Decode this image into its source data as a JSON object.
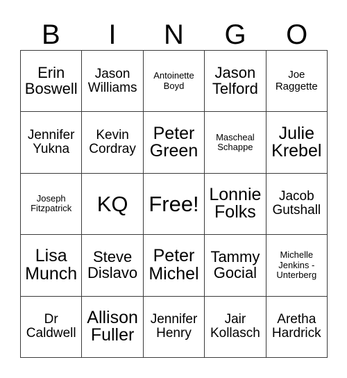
{
  "card": {
    "type": "bingo-card",
    "columns": 5,
    "rows": 5,
    "border_color": "#3a3a3a",
    "background_color": "#ffffff",
    "text_color": "#000000"
  },
  "header": {
    "letters": [
      "B",
      "I",
      "N",
      "G",
      "O"
    ]
  },
  "grid": {
    "rows": [
      [
        {
          "text": "Erin Boswell",
          "size": "l"
        },
        {
          "text": "Jason Williams",
          "size": "m"
        },
        {
          "text": "Antoinette Boyd",
          "size": "xs"
        },
        {
          "text": "Jason Telford",
          "size": "l"
        },
        {
          "text": "Joe Raggette",
          "size": "s"
        }
      ],
      [
        {
          "text": "Jennifer Yukna",
          "size": "m"
        },
        {
          "text": "Kevin Cordray",
          "size": "m"
        },
        {
          "text": "Peter Green",
          "size": "xl"
        },
        {
          "text": "Mascheal Schappe",
          "size": "xs"
        },
        {
          "text": "Julie Krebel",
          "size": "xl"
        }
      ],
      [
        {
          "text": "Joseph Fitzpatrick",
          "size": "xs"
        },
        {
          "text": "KQ",
          "size": "xxl"
        },
        {
          "text": "Free!",
          "size": "xxl"
        },
        {
          "text": "Lonnie Folks",
          "size": "xl"
        },
        {
          "text": "Jacob Gutshall",
          "size": "m"
        }
      ],
      [
        {
          "text": "Lisa Munch",
          "size": "xl"
        },
        {
          "text": "Steve Dislavo",
          "size": "l"
        },
        {
          "text": "Peter Michel",
          "size": "xl"
        },
        {
          "text": "Tammy Gocial",
          "size": "l"
        },
        {
          "text": "Michelle Jenkins - Unterberg",
          "size": "xs"
        }
      ],
      [
        {
          "text": "Dr Caldwell",
          "size": "m"
        },
        {
          "text": "Allison Fuller",
          "size": "xl"
        },
        {
          "text": "Jennifer Henry",
          "size": "m"
        },
        {
          "text": "Jair Kollasch",
          "size": "m"
        },
        {
          "text": "Aretha Hardrick",
          "size": "m"
        }
      ]
    ]
  }
}
